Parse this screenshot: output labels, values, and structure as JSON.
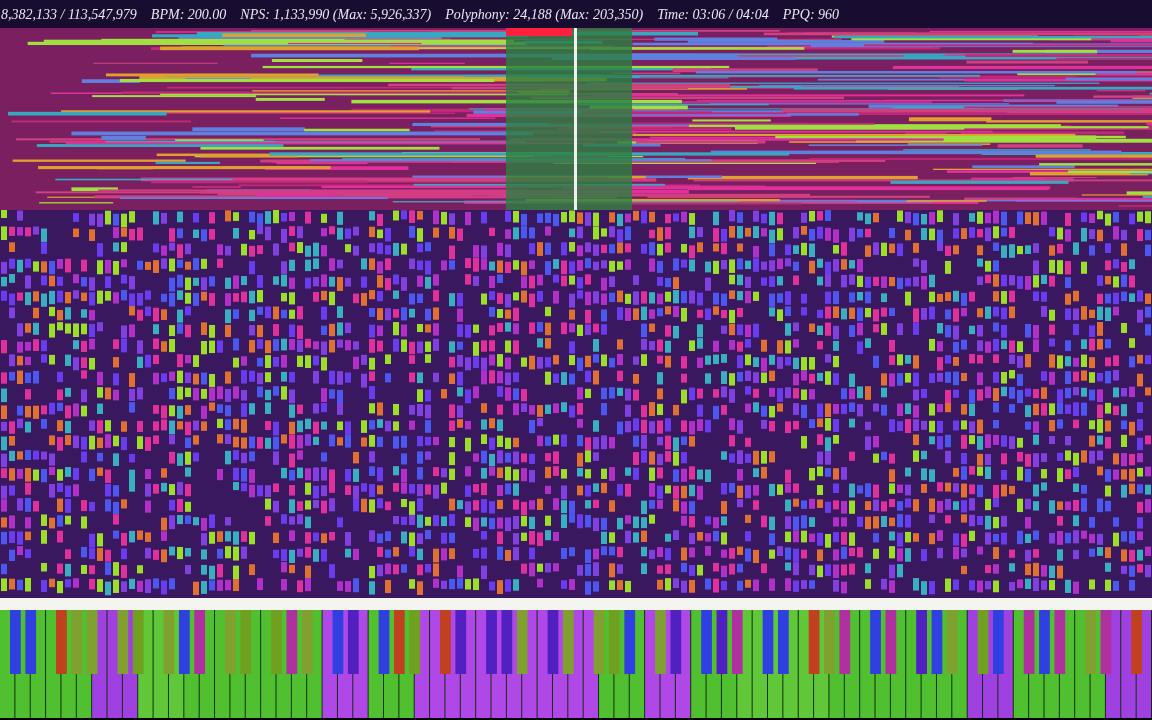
{
  "stats_bar": [
    "8,382,133 / 113,547,979",
    "BPM: 200.00",
    "NPS: 1,133,990 (Max: 5,926,337)",
    "Polyphony: 24,188 (Max: 203,350)",
    "Time: 03:06 / 04:04",
    "PPQ: 960"
  ]
}
